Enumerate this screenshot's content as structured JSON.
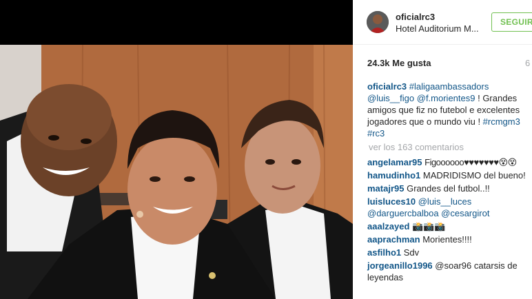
{
  "post": {
    "username": "oficialrc3",
    "location": "Hotel Auditorium M...",
    "follow_label": "SEGUIR",
    "likes": "24.3k Me gusta",
    "time": "6"
  },
  "caption": {
    "user": "oficialrc3",
    "tag1": "#laligaambassadors",
    "mention1": "@luis__figo",
    "mention2": "@f.morientes9",
    "text": " ! Grandes amigos que fiz no futebol e excelentes jogadores que o mundo viu ! ",
    "tag2": "#rcmgm3",
    "tag3": "#rc3"
  },
  "load_more": "ver los 163 comentarios",
  "comments": [
    {
      "user": "angelamar95",
      "text": "Figoooooo♥♥♥♥♥♥♥😵😵"
    },
    {
      "user": "hamudinho1",
      "text": "MADRIDISMO del bueno!"
    },
    {
      "user": "matajr95",
      "text": "Grandes del futbol..!!"
    },
    {
      "user": "luisluces10",
      "text": "@luis__luces @darguercbalboa @cesargirot"
    },
    {
      "user": "aaalzayed",
      "text": "📸📸📸"
    },
    {
      "user": "aaprachman",
      "text": "Morientes!!!!"
    },
    {
      "user": "asfilho1",
      "text": "Sdv"
    },
    {
      "user": "jorgeanillo1996",
      "text": "@soar96 catarsis de leyendas"
    }
  ],
  "colors": {
    "link": "#125688",
    "follow_green": "#70c050",
    "muted": "#a5a7aa",
    "text": "#262626"
  },
  "icons": {
    "avatar": "profile-avatar"
  }
}
